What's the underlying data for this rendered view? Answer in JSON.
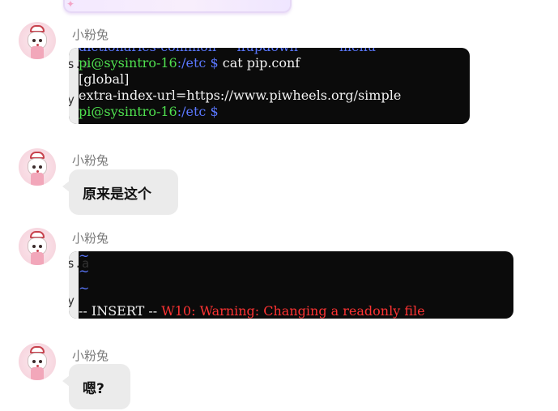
{
  "messages": [
    {
      "sender": "小粉兔",
      "type": "image",
      "image": {
        "side_fragments": [
          "s.a",
          "y"
        ],
        "lines": [
          [
            {
              "text": "dictionaries-common     ifupdown          menu",
              "color": "blue"
            }
          ],
          [
            {
              "text": "pi@sysintro-16",
              "color": "green"
            },
            {
              "text": ":/etc ",
              "color": "blue"
            },
            {
              "text": "$",
              "color": "blue"
            },
            {
              "text": " cat pip.conf",
              "color": "white"
            }
          ],
          [
            {
              "text": "[global]",
              "color": "white"
            }
          ],
          [
            {
              "text": "extra-index-url=https://www.piwheels.org/simple",
              "color": "white"
            }
          ],
          [
            {
              "text": "pi@sysintro-16",
              "color": "green"
            },
            {
              "text": ":/etc ",
              "color": "blue"
            },
            {
              "text": "$",
              "color": "blue"
            }
          ]
        ]
      }
    },
    {
      "sender": "小粉兔",
      "type": "text",
      "text": "原来是这个"
    },
    {
      "sender": "小粉兔",
      "type": "image",
      "image": {
        "side_fragments": [
          "s.a",
          "y"
        ],
        "lines": [
          [
            {
              "text": "~",
              "color": "blue"
            }
          ],
          [
            {
              "text": "~",
              "color": "blue"
            }
          ],
          [
            {
              "text": "~",
              "color": "blue"
            }
          ],
          [
            {
              "text": "-- INSERT --",
              "color": "white"
            },
            {
              "text": " W10: Warning: Changing a readonly file",
              "color": "red"
            }
          ]
        ]
      }
    },
    {
      "sender": "小粉兔",
      "type": "text",
      "text": "嗯?"
    }
  ]
}
